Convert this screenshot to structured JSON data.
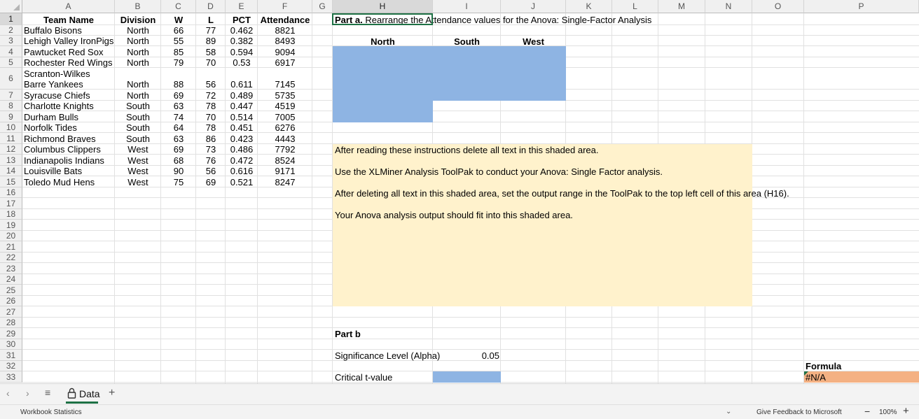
{
  "columns": [
    "A",
    "B",
    "C",
    "D",
    "E",
    "F",
    "G",
    "H",
    "I",
    "J",
    "K",
    "L",
    "M",
    "N",
    "O",
    "P"
  ],
  "selected_column": "H",
  "selected_row": "1",
  "headers": {
    "team": "Team Name",
    "division": "Division",
    "w": "W",
    "l": "L",
    "pct": "PCT",
    "attendance": "Attendance"
  },
  "teams": [
    {
      "name": "Buffalo Bisons",
      "division": "North",
      "w": "66",
      "l": "77",
      "pct": "0.462",
      "attendance": "8821"
    },
    {
      "name": "Lehigh Valley IronPigs",
      "division": "North",
      "w": "55",
      "l": "89",
      "pct": "0.382",
      "attendance": "8493"
    },
    {
      "name": "Pawtucket Red Sox",
      "division": "North",
      "w": "85",
      "l": "58",
      "pct": "0.594",
      "attendance": "9094"
    },
    {
      "name": "Rochester Red Wings",
      "division": "North",
      "w": "79",
      "l": "70",
      "pct": "0.53",
      "attendance": "6917"
    },
    {
      "name": "Scranton-Wilkes",
      "name_line2": "Barre Yankees",
      "division": "North",
      "w": "88",
      "l": "56",
      "pct": "0.611",
      "attendance": "7145"
    },
    {
      "name": "Syracuse Chiefs",
      "division": "North",
      "w": "69",
      "l": "72",
      "pct": "0.489",
      "attendance": "5735"
    },
    {
      "name": "Charlotte Knights",
      "division": "South",
      "w": "63",
      "l": "78",
      "pct": "0.447",
      "attendance": "4519"
    },
    {
      "name": "Durham Bulls",
      "division": "South",
      "w": "74",
      "l": "70",
      "pct": "0.514",
      "attendance": "7005"
    },
    {
      "name": "Norfolk Tides",
      "division": "South",
      "w": "64",
      "l": "78",
      "pct": "0.451",
      "attendance": "6276"
    },
    {
      "name": "Richmond Braves",
      "division": "South",
      "w": "63",
      "l": "86",
      "pct": "0.423",
      "attendance": "4443"
    },
    {
      "name": "Columbus Clippers",
      "division": "West",
      "w": "69",
      "l": "73",
      "pct": "0.486",
      "attendance": "7792"
    },
    {
      "name": "Indianapolis Indians",
      "division": "West",
      "w": "68",
      "l": "76",
      "pct": "0.472",
      "attendance": "8524"
    },
    {
      "name": "Louisville Bats",
      "division": "West",
      "w": "90",
      "l": "56",
      "pct": "0.616",
      "attendance": "9171"
    },
    {
      "name": "Toledo Mud Hens",
      "division": "West",
      "w": "75",
      "l": "69",
      "pct": "0.521",
      "attendance": "8247"
    }
  ],
  "part_a": {
    "title_bold": "Part a.",
    "title_rest": " Rearrange the Attendance values for the Anova: Single-Factor Analysis",
    "groups": [
      "North",
      "South",
      "West"
    ]
  },
  "instructions": [
    "After reading these instructions delete all text in this shaded area.",
    "Use the XLMiner Analysis ToolPak to conduct your Anova: Single Factor analysis.",
    "After deleting all text in this shaded area, set the output range in the ToolPak to the top left cell of this area (H16).",
    "Your Anova analysis output should fit into this shaded area."
  ],
  "part_b": {
    "title": "Part b",
    "alpha_label": "Significance Level (Alpha)",
    "alpha_value": "0.05",
    "critical_label": "Critical t-value",
    "formula_label": "Formula",
    "formula_value": "#N/A"
  },
  "sheet_tab": "Data",
  "status": {
    "left": "Workbook Statistics",
    "feedback": "Give Feedback to Microsoft",
    "zoom": "100%"
  },
  "colors": {
    "blue_fill": "#8eb4e3",
    "yellow_fill": "#fff2cc",
    "orange_fill": "#f4b183",
    "active_green": "#1e7145"
  }
}
